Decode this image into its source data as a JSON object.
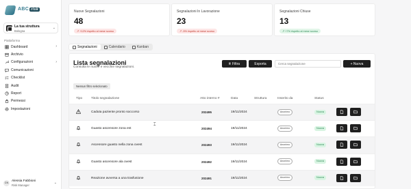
{
  "logo": {
    "text": "ABC",
    "badge": "risk"
  },
  "structure": {
    "name": "La tua struttura",
    "location": "Bologna"
  },
  "sidebar": {
    "section_label": "Piattaforma",
    "items": [
      {
        "label": "Dashboard",
        "icon": "dashboard-icon",
        "has_chevron": true
      },
      {
        "label": "Archivio",
        "icon": "archive-icon",
        "has_chevron": false
      },
      {
        "label": "Configurazioni",
        "icon": "wrench-icon",
        "has_chevron": true
      },
      {
        "label": "Comunicazioni",
        "icon": "chat-icon",
        "has_chevron": false
      },
      {
        "label": "Checklist",
        "icon": "checklist-icon",
        "has_chevron": false
      },
      {
        "label": "Audit",
        "icon": "audit-icon",
        "has_chevron": false
      },
      {
        "label": "Report",
        "icon": "chart-icon",
        "has_chevron": false
      },
      {
        "label": "Permessi",
        "icon": "lock-icon",
        "has_chevron": false
      },
      {
        "label": "Impostazioni",
        "icon": "gear-icon",
        "has_chevron": false
      }
    ]
  },
  "user": {
    "initials": "CN",
    "name": "Alessia Fabbioni",
    "role": "Risk Manager"
  },
  "stats": [
    {
      "title": "Nuove Segnalazioni",
      "value": "48",
      "trend": "+12% rispetto al mese scorso",
      "trend_color": "red"
    },
    {
      "title": "Segnalazioni In Lavorazione",
      "value": "23",
      "trend": "-5% rispetto al mese scorso",
      "trend_color": "red"
    },
    {
      "title": "Segnalazioni Chiuse",
      "value": "13",
      "trend": "+7% rispetto al mese scorso",
      "trend_color": "green"
    }
  ],
  "tabs": [
    {
      "label": "Segnalazioni",
      "active": true
    },
    {
      "label": "Calendario",
      "active": false
    },
    {
      "label": "Kanban",
      "active": false
    }
  ],
  "panel": {
    "title": "Lista segnalazioni",
    "subtitle": "Consulta le nuove e vecchie segnalazioni.",
    "filter_label": "Filtra",
    "export_label": "Esporta",
    "search_placeholder": "Cerca segnalazione",
    "new_label": "+ Nuova",
    "filter_chip": "Nessun filtro selezionato"
  },
  "table": {
    "headers": [
      "Tipo",
      "Titolo segnalazione",
      "Atto interno #",
      "Data",
      "Struttura",
      "Inserito da",
      "Status"
    ],
    "rows": [
      {
        "type_icon": "warning-icon",
        "title": "Caduta paziente pronto soccorso",
        "number": "202495",
        "date": "19/11/2024",
        "struttura": "",
        "inserted_by": "Anonimo",
        "status": "Nuova"
      },
      {
        "type_icon": "bell-icon",
        "title": "Guasto ascensore zona est",
        "number": "202494",
        "date": "19/11/2024",
        "struttura": "",
        "inserted_by": "Anonimo",
        "status": "Nuova"
      },
      {
        "type_icon": "bell-icon",
        "title": "Ascensore guasto nella zona ovest",
        "number": "202493",
        "date": "19/11/2024",
        "struttura": "",
        "inserted_by": "Anonimo",
        "status": "Nuova"
      },
      {
        "type_icon": "bell-icon",
        "title": "Guasto ascensore ala ovest",
        "number": "202492",
        "date": "19/11/2024",
        "struttura": "",
        "inserted_by": "Anonimo",
        "status": "Nuova"
      },
      {
        "type_icon": "bell-icon",
        "title": "Reazione avversa a una trasfusione",
        "number": "202491",
        "date": "19/11/2024",
        "struttura": "",
        "inserted_by": "Anonimo",
        "status": "Nuova"
      }
    ]
  }
}
